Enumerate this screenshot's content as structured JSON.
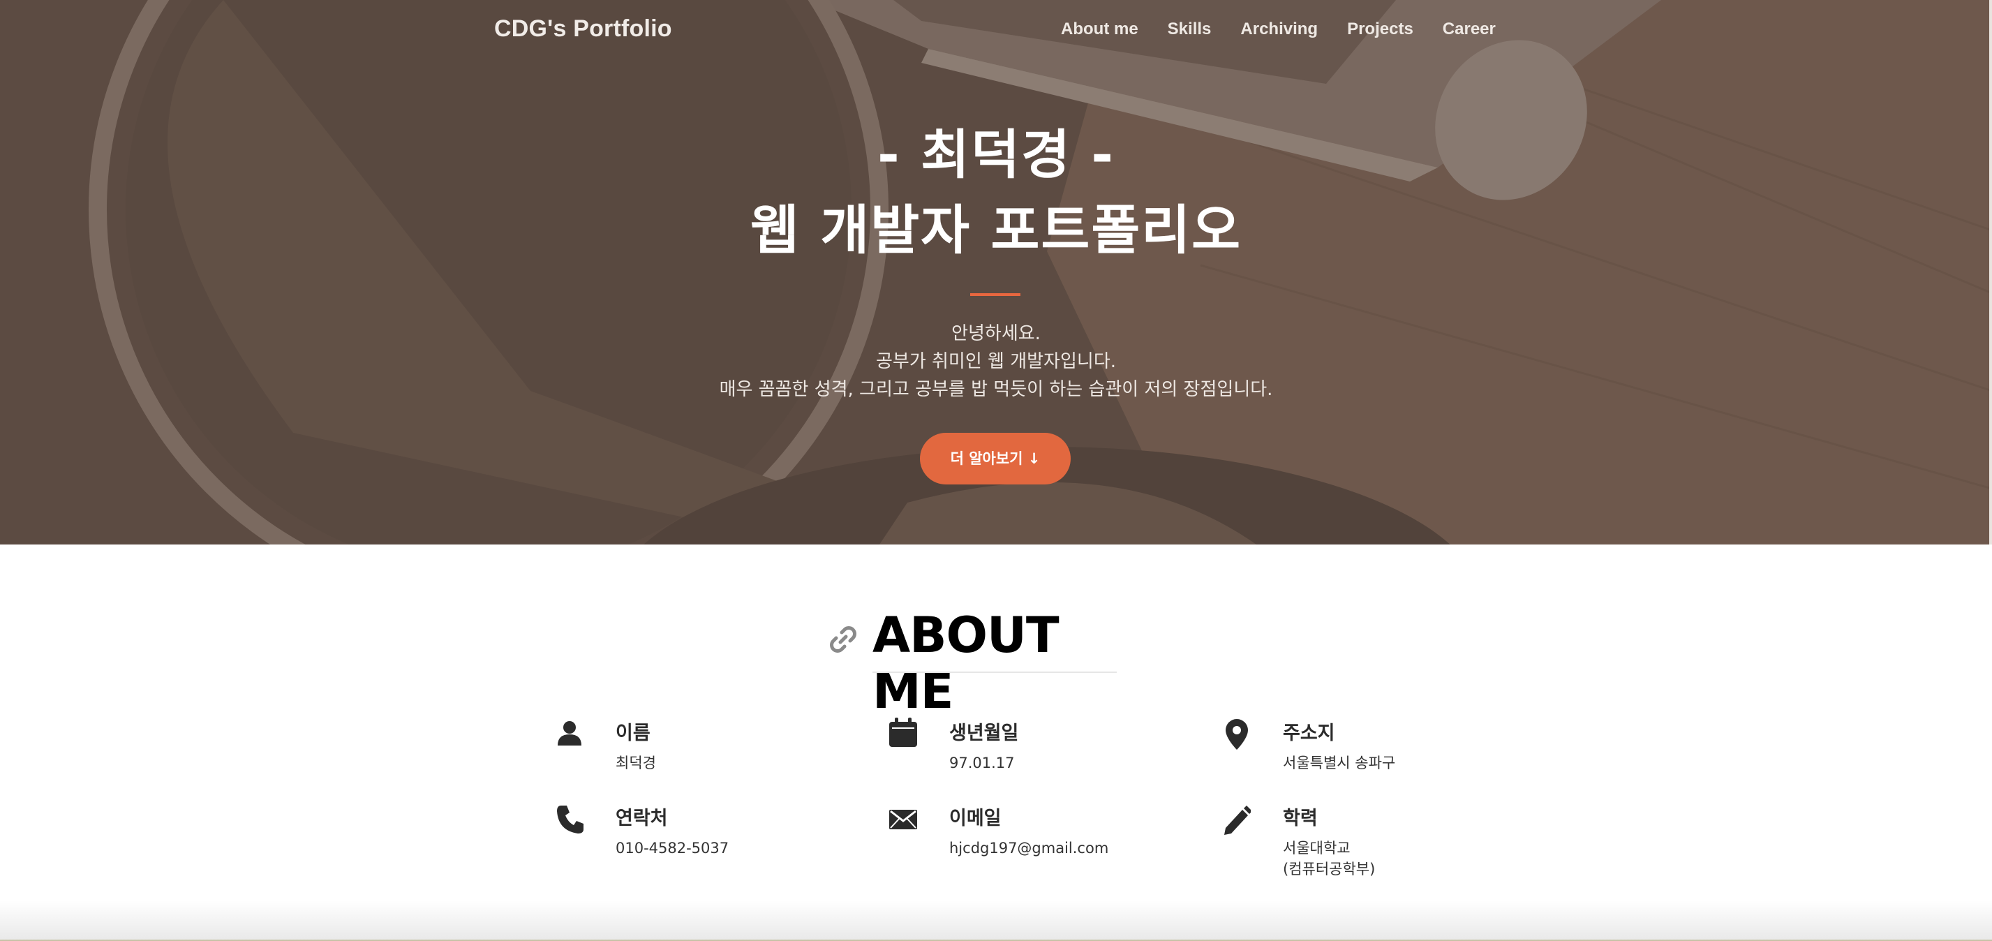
{
  "brand": "CDG's Portfolio",
  "nav": [
    "About me",
    "Skills",
    "Archiving",
    "Projects",
    "Career"
  ],
  "hero": {
    "title_line1": "- 최덕경 -",
    "title_line2": "웹 개발자 포트폴리오",
    "intro": [
      "안녕하세요.",
      "공부가 취미인 웹 개발자입니다.",
      "매우 꼼꼼한 성격, 그리고 공부를 밥 먹듯이 하는 습관이 저의 장점입니다."
    ],
    "button": "더 알아보기 ↓"
  },
  "about": {
    "title": "ABOUT ME",
    "items": [
      {
        "icon": "person-icon",
        "label": "이름",
        "value": "최덕경"
      },
      {
        "icon": "calendar-icon",
        "label": "생년월일",
        "value": "97.01.17"
      },
      {
        "icon": "location-pin-icon",
        "label": "주소지",
        "value": "서울특별시 송파구"
      },
      {
        "icon": "phone-icon",
        "label": "연락처",
        "value": "010-4582-5037"
      },
      {
        "icon": "envelope-icon",
        "label": "이메일",
        "value": "hjcdg197@gmail.com"
      },
      {
        "icon": "pencil-icon",
        "label": "학력",
        "value": "서울대학교",
        "value2": "(컴퓨터공학부)"
      }
    ]
  },
  "colors": {
    "accent": "#e2683f",
    "hero_overlay": "#5f4f45",
    "text_dark": "#2b2b2b"
  }
}
